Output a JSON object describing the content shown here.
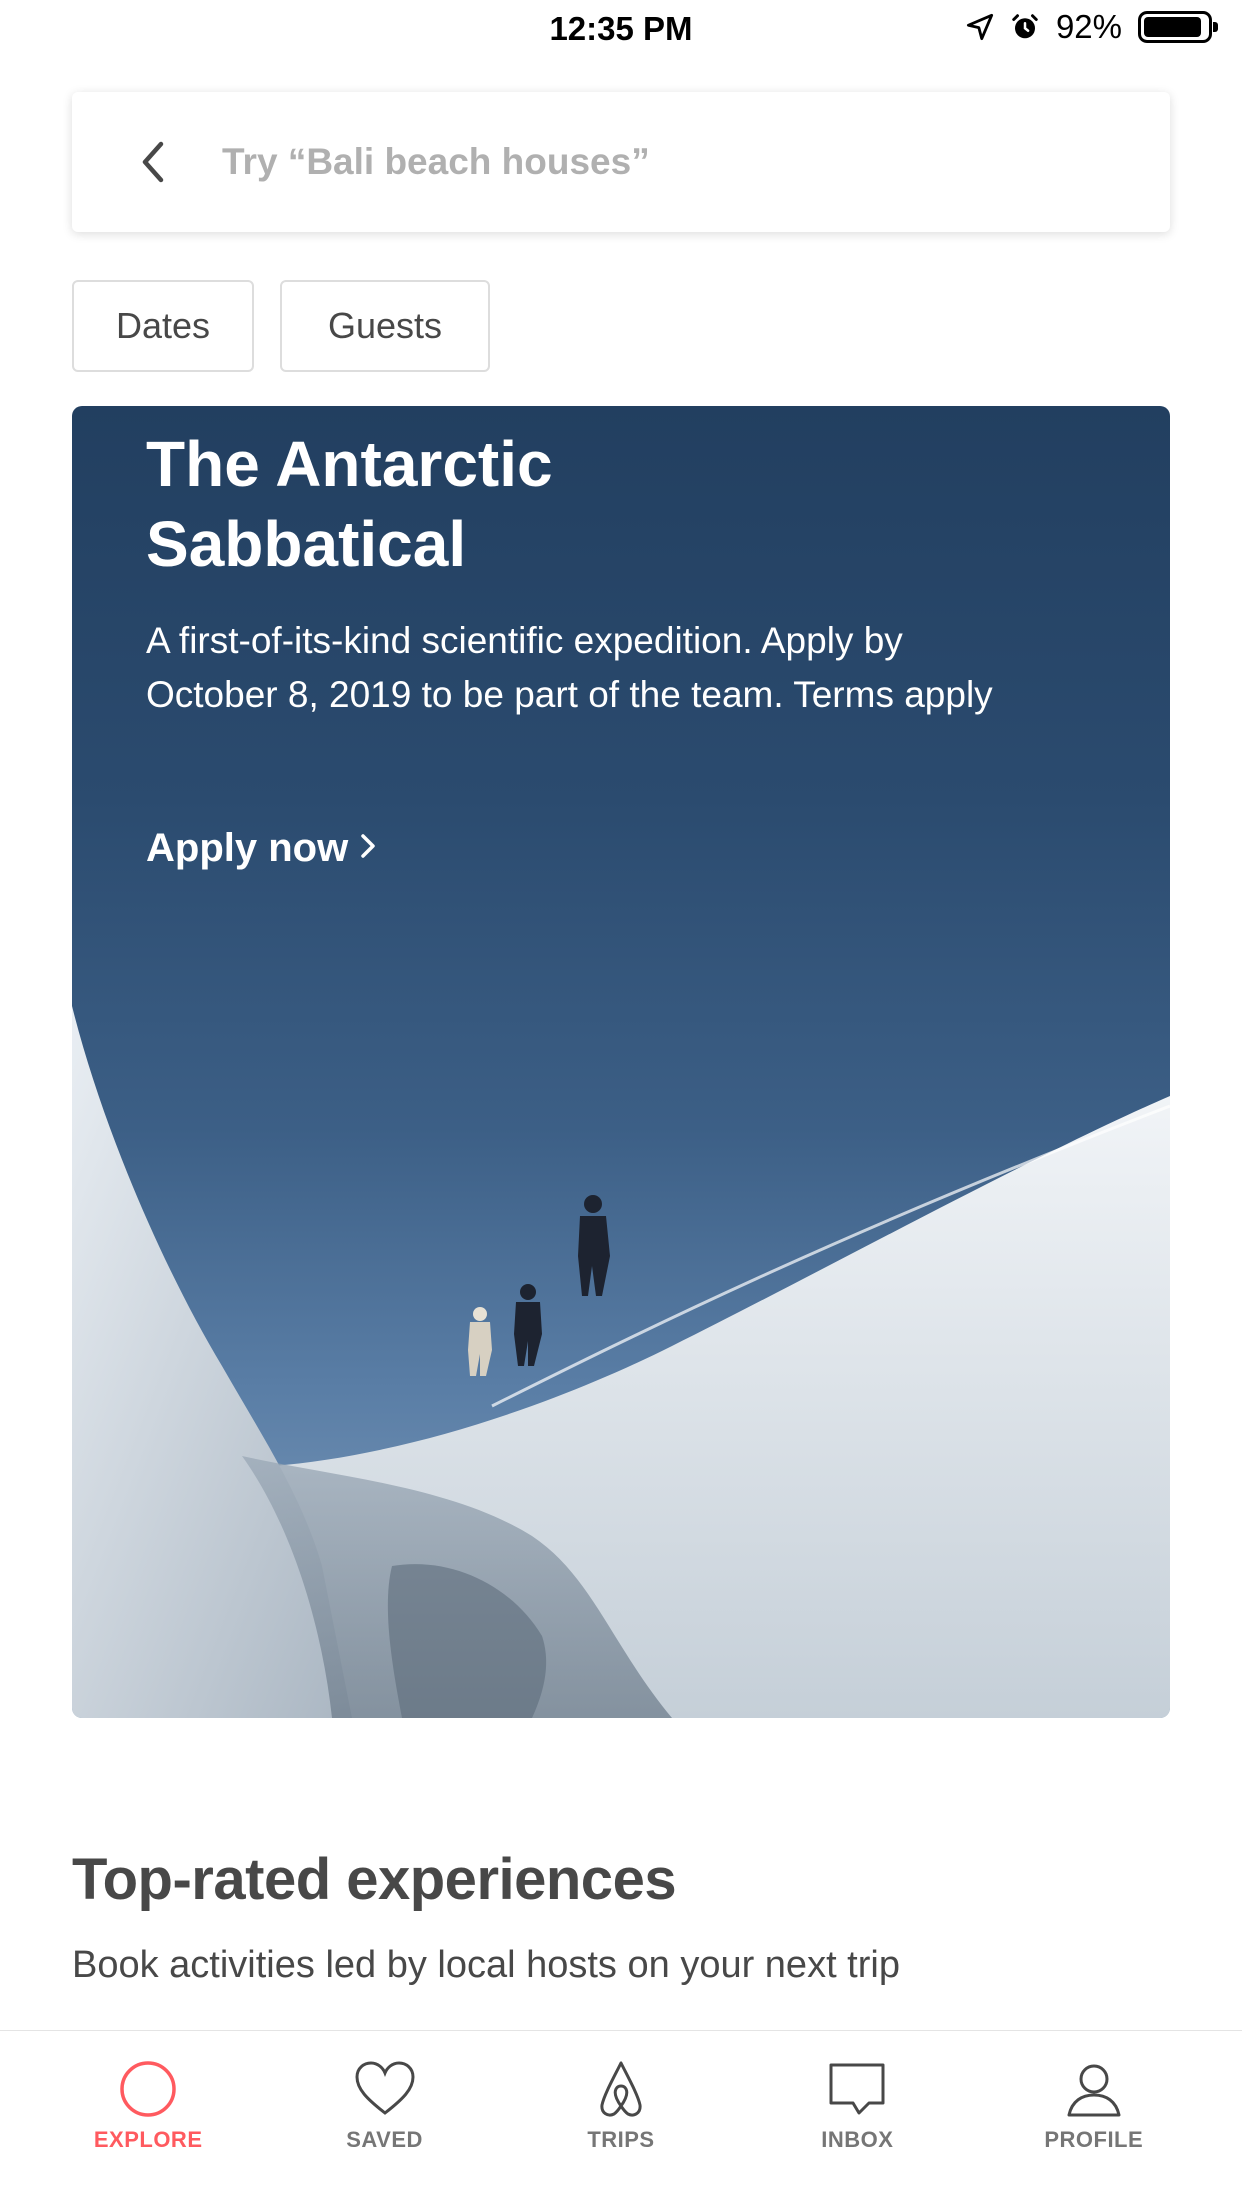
{
  "status_bar": {
    "time": "12:35 PM",
    "battery_text": "92%",
    "battery_level": 0.92,
    "icons": [
      "location-arrow-icon",
      "alarm-icon",
      "battery-icon"
    ]
  },
  "search": {
    "placeholder": "Try “Bali beach houses”",
    "value": "",
    "back_icon": "chevron-left-icon"
  },
  "filters": [
    {
      "label": "Dates"
    },
    {
      "label": "Guests"
    }
  ],
  "hero": {
    "title": "The Antarctic Sabbatical",
    "description": "A first-of-its-kind scientific expedition. Apply by October 8, 2019 to be part of the team. Terms apply",
    "cta_label": "Apply now",
    "cta_icon": "chevron-right-icon"
  },
  "section": {
    "title": "Top-rated experiences",
    "subtitle": "Book activities led by local hosts on your next trip"
  },
  "bottom_nav": {
    "active": "EXPLORE",
    "items": [
      {
        "label": "EXPLORE",
        "icon": "search-icon"
      },
      {
        "label": "SAVED",
        "icon": "heart-icon"
      },
      {
        "label": "TRIPS",
        "icon": "airbnb-logo-icon"
      },
      {
        "label": "INBOX",
        "icon": "message-icon"
      },
      {
        "label": "PROFILE",
        "icon": "user-icon"
      }
    ]
  },
  "colors": {
    "brand": "#ff5a5f",
    "text": "#484848",
    "muted": "#767676",
    "placeholder": "#b0b0b0"
  }
}
